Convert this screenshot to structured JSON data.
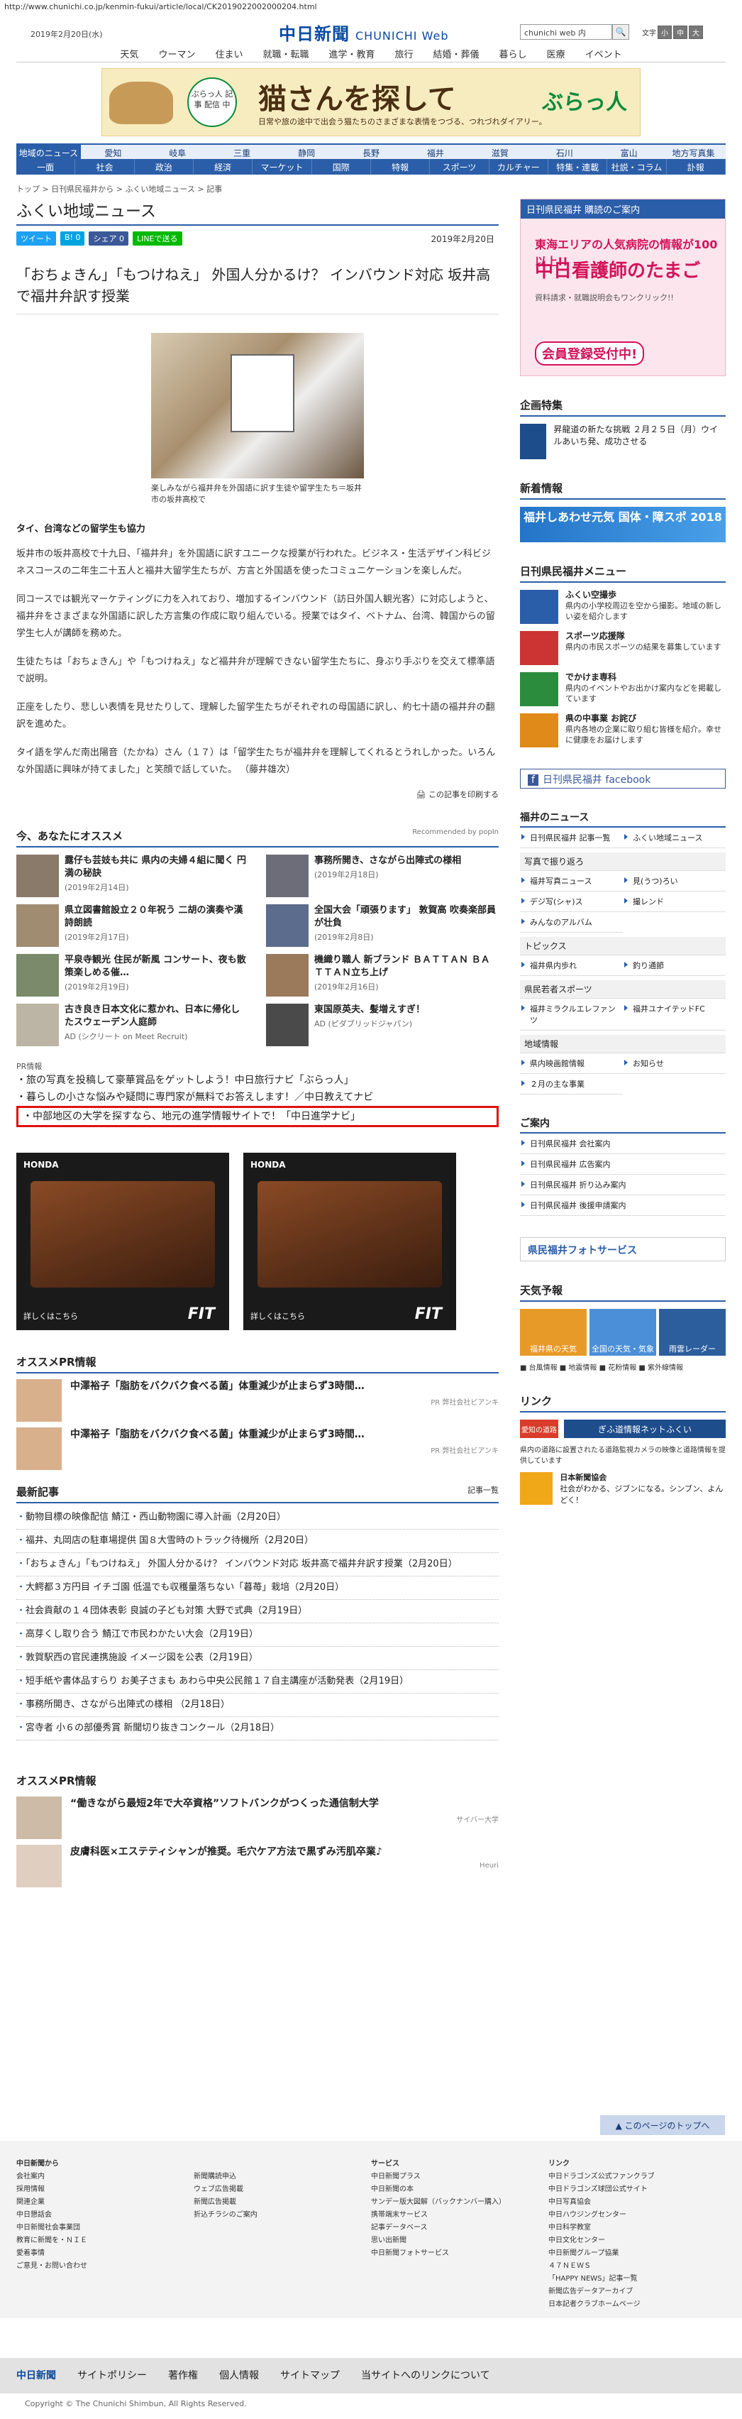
{
  "url": "http://www.chunichi.co.jp/kenmin-fukui/article/local/CK2019022002000204.html",
  "header": {
    "date": "2019年2月20日(水)",
    "logo": "中日新聞",
    "logo_web": "CHUNICHI Web",
    "search_placeholder": "chunichi web 内",
    "font_size_label": "文字",
    "font_small": "小",
    "font_mid": "中",
    "font_large": "大"
  },
  "nav1": [
    "天気",
    "ウーマン",
    "住まい",
    "就職・転職",
    "進学・教育",
    "旅行",
    "結婚・葬儀",
    "暮らし",
    "医療",
    "イベント"
  ],
  "banner": {
    "circle": "ぶらっ人 記事 配信 中",
    "title": "猫さんを探して",
    "sub": "日常や旅の途中で出会う猫たちのさまざまな表情をつづる、つれづれダイアリー。",
    "brand": "ぶらっ人"
  },
  "nav2": [
    "地域のニュース",
    "愛知",
    "岐阜",
    "三重",
    "静岡",
    "長野",
    "福井",
    "滋賀",
    "石川",
    "富山",
    "地方写真集"
  ],
  "nav3": [
    "一面",
    "社会",
    "政治",
    "経済",
    "マーケット",
    "国際",
    "特報",
    "スポーツ",
    "カルチャー",
    "特集・連載",
    "社説・コラム",
    "訃報"
  ],
  "crumb": "トップ > 日刊県民福井から > ふくい地域ニュース > 記事",
  "section_title": "ふくい地域ニュース",
  "share": {
    "tw": "ツイート",
    "hb": "B! 0",
    "fb": "シェア 0",
    "ln": "LINEで送る",
    "date": "2019年2月20日"
  },
  "headline": "「おちょきん」「もつけねえ」 外国人分かるけ？ インバウンド対応 坂井高で福井弁訳す授業",
  "photo_caption": "楽しみながら福井弁を外国語に訳す生徒や留学生たち＝坂井市の坂井高校で",
  "subhead": "タイ、台湾などの留学生も協力",
  "body": [
    "坂井市の坂井高校で十九日、「福井弁」を外国語に訳すユニークな授業が行われた。ビジネス・生活デザイン科ビジネスコースの二年生二十五人と福井大留学生たちが、方言と外国語を使ったコミュニケーションを楽しんだ。",
    "同コースでは観光マーケティングに力を入れており、増加するインバウンド（訪日外国人観光客）に対応しようと、福井弁をさまざまな外国語に訳した方言集の作成に取り組んでいる。授業ではタイ、ベトナム、台湾、韓国からの留学生七人が講師を務めた。",
    "生徒たちは「おちょきん」や「もつけねえ」など福井弁が理解できない留学生たちに、身ぶり手ぶりを交えて標準語で説明。",
    "正座をしたり、悲しい表情を見せたりして、理解した留学生たちがそれぞれの母国語に訳し、約七十語の福井弁の翻訳を進めた。",
    "タイ語を学んだ南出陽音（たかね）さん（１７）は「留学生たちが福井弁を理解してくれるとうれしかった。いろんな外国語に興味が持てました」と笑顔で話していた。 （藤井雄次）"
  ],
  "print_link": "この記事を印刷する",
  "reco": {
    "title": "今、あなたにオススメ",
    "powered": "Recommended by popIn",
    "items": [
      {
        "title": "露仔も芸妓も共に 県内の夫婦４組に聞く 円満の秘訣",
        "meta": "(2019年2月14日)"
      },
      {
        "title": "事務所開き、さながら出陣式の様相",
        "meta": "(2019年2月18日)"
      },
      {
        "title": "県立図書館設立２０年祝う 二胡の演奏や漢詩朗読",
        "meta": "(2019年2月17日)"
      },
      {
        "title": "全国大会「頑張ります」 敦賀高 吹奏楽部員が壮負",
        "meta": "(2019年2月8日)"
      },
      {
        "title": "平泉寺観光 住民が新風 コンサート、夜も散策楽しめる催…",
        "meta": "(2019年2月19日)"
      },
      {
        "title": "機織り職人 新ブランド ＢＡＴＴＡＮ ＢＡＴＴＡＮ立ち上げ",
        "meta": "(2019年2月16日)"
      },
      {
        "title": "古き良き日本文化に惹かれ、日本に帰化したスウェーデン人庭師",
        "meta": "AD (シクリート on Meet Recruit)"
      },
      {
        "title": "東国原英夫、髪増えすぎ！",
        "meta": "AD (ピダブリッドジャパン)"
      }
    ]
  },
  "pr": {
    "label": "PR情報",
    "lines": [
      "旅の写真を投稿して豪華賞品をゲットしよう！中日旅行ナビ「ぶらっ人」",
      "暮らしの小さな悩みや疑問に専門家が無料でお答えします！／中日教えてナビ",
      "中部地区の大学を探すなら、地元の進学情報サイトで！「中日進学ナビ」"
    ]
  },
  "ads": {
    "more": "詳しくはこちら",
    "brand": "HONDA",
    "model": "FIT"
  },
  "pr_info": {
    "title": "オススメPR情報",
    "items": [
      {
        "title": "中澤裕子「脂肪をバクバク食べる菌」体重減少が止まらず3時間…",
        "src": "PR 弊社会社ビアンキ"
      },
      {
        "title": "中澤裕子「脂肪をバクバク食べる菌」体重減少が止まらず3時間…",
        "src": "PR 弊社会社ビアンキ"
      }
    ]
  },
  "latest": {
    "title": "最新記事",
    "more": "記事一覧",
    "rows": [
      "動物目標の映像配信 鯖江・西山動物園に導入計画（2月20日）",
      "福井、丸岡店の駐車場提供 国８大雪時のトラック待機所（2月20日）",
      "「おちょきん」「もつけねえ」 外国人分かるけ？ インバウンド対応 坂井高で福井弁訳す授業（2月20日）",
      "大鰐都３方円目 イチゴ園 低温でも収穫量落ちない「暮苺」栽培（2月20日）",
      "社会貢献の１４団体表彰 良誠の子ども対策 大野で式典（2月19日）",
      "高芽くし取り合う 鯖江で市民わかたい大会（2月19日）",
      "敦賀駅西の官民連携施設 イメージ図を公表（2月19日）",
      "短手紙や書体品すらり お美子さまも あわら中央公民館１７自主講座が活動発表（2月19日）",
      "事務所開き、さながら出陣式の様相 （2月18日）",
      "宮寺者 小６の部優秀賞 新聞切り抜きコンクール（2月18日）"
    ]
  },
  "pr_info2": {
    "title": "オススメPR情報",
    "items": [
      {
        "title": "“働きながら最短2年で大卒資格”ソフトバンクがつくった通信制大学",
        "src": "サイバー大学"
      },
      {
        "title": "皮膚科医×エステティシャンが推奨。毛穴ケア方法で黒ずみ汚肌卒業♪",
        "src": "Heuri"
      }
    ]
  },
  "right": {
    "promo_bar": "日刊県民福井 購読のご案内",
    "promo1": "東海エリアの人気病院の情報が100以上!!",
    "promo2": "中日看護師のたまご",
    "promo3": "資料請求・就職説明会もワンクリック!!",
    "promo4": "会員登録受付中!",
    "kikaku_title": "企画特集",
    "kikaku_text": "昇龍道の新たな挑戦 ２月２５日（月）ウイルあいち発、成功させる",
    "shinchaku_title": "新着情報",
    "shinchaku_banner": "福井しあわせ元気 国体・障スポ 2018",
    "menu_title": "日刊県民福井メニュー",
    "menu": [
      {
        "name": "ふくい空撮歩",
        "text": "県内の小学校周辺を空から撮影。地域の新しい姿を紹介します"
      },
      {
        "name": "スポーツ応援隊",
        "text": "県内の市民スポーツの結果を募集しています"
      },
      {
        "name": "でかけま専科",
        "text": "県内のイベントやお出かけ案内などを掲載しています"
      },
      {
        "name": "県の中事業 お詫び",
        "text": "県内各地の企業に取り組む皆様を紹介。幸せに健康をお届けします"
      }
    ],
    "fb": "日刊県民福井 facebook",
    "news_title": "福井のニュース",
    "news": [
      "日刊県民福井 記事一覧",
      "ふくい地域ニュース"
    ],
    "photo_title": "写真で振り返ろ",
    "photo_list": [
      "福井写真ニュース",
      "見(うつ)ろい",
      "デジ写(シャ)ス",
      "撮レンド",
      "みんなのアルバム"
    ],
    "topics_title": "トピックス",
    "topics": [
      "福井県内歩れ",
      "釣り通節"
    ],
    "sports_title": "県民若者スポーツ",
    "sports": [
      "福井ミラクルエレファンツ",
      "福井ユナイテッドFC"
    ],
    "local_title": "地域情報",
    "local": [
      "県内映画館情報",
      "お知らせ",
      "２月の主な事業"
    ],
    "annai_title": "ご案内",
    "annai": [
      "日刊県民福井 会社案内",
      "日刊県民福井 広告案内",
      "日刊県民福井 折り込み案内",
      "日刊県民福井 後援申請案内"
    ],
    "photosvc": "県民福井フォトサービス",
    "weather_title": "天気予報",
    "weather": [
      "福井県の天気",
      "全国の天気・気象",
      "雨雲レーダー"
    ],
    "weather_links": "■ 台風情報  ■ 地震情報  ■ 花粉情報  ■ 紫外線情報",
    "link_title": "リンク",
    "link1": "愛知の道路",
    "link2": "ぎふ道情報ネットふくい",
    "link_desc": "県内の道路に設置されたる道路監視カメラの映像と道路情報を提供しています",
    "jk_name": "日本新聞協会",
    "jk_text": "社会がわかる、ジブンになる。シンブン、よんどく！"
  },
  "totop": "このページのトップへ",
  "footer": {
    "c1": [
      "中日新聞から",
      "会社案内",
      "採用情報",
      "関連企業",
      "中日懇話会",
      "中日新聞社会事業団",
      "教育に新聞を・ＮＩＥ",
      "愛着事情",
      "ご意見・お問い合わせ"
    ],
    "c2": [
      "新聞購読申込",
      "ウェブ広告掲載",
      "新聞広告掲載",
      "折込チラシのご案内"
    ],
    "c3": [
      "サービス",
      "中日新聞プラス",
      "中日新聞の本",
      "サンデー版大図解（バックナンバー購入）",
      "携帯端末サービス",
      "記事データベース",
      "思い出新聞",
      "中日新聞フォトサービス"
    ],
    "c4": [
      "リンク",
      "中日ドラゴンズ公式ファンクラブ",
      "中日ドラゴンズ球団公式サイト",
      "中日写真協会",
      "中日ハウジングセンター",
      "中日科学教室",
      "中日文化センター",
      "中日新聞グループ協業",
      "４７ＮＥＷＳ",
      "「HAPPY NEWS」記事一覧",
      "新聞広告データアーカイブ",
      "日本記者クラブホームページ"
    ]
  },
  "bottom": [
    "中日新聞",
    "サイトポリシー",
    "著作権",
    "個人情報",
    "サイトマップ",
    "当サイトへのリンクについて"
  ],
  "copyright": "Copyright © The Chunichi Shimbun, All Rights Reserved."
}
